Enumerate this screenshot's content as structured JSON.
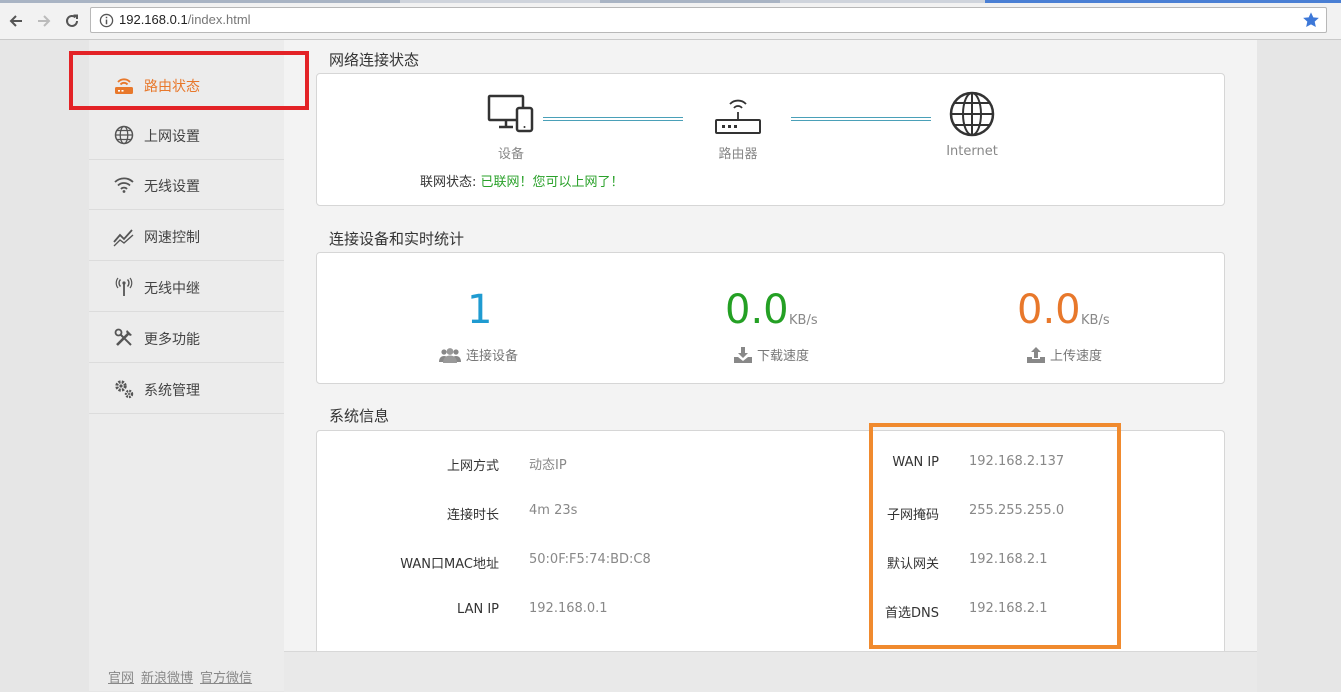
{
  "browser": {
    "url_host": "192.168.0.1",
    "url_path": "/index.html"
  },
  "sidebar": {
    "items": [
      {
        "label": "路由状态",
        "icon": "router-icon",
        "active": true
      },
      {
        "label": "上网设置",
        "icon": "globe-icon"
      },
      {
        "label": "无线设置",
        "icon": "wifi-icon"
      },
      {
        "label": "网速控制",
        "icon": "speed-chart-icon"
      },
      {
        "label": "无线中继",
        "icon": "antenna-icon"
      },
      {
        "label": "更多功能",
        "icon": "tools-icon"
      },
      {
        "label": "系统管理",
        "icon": "gears-icon"
      }
    ],
    "footer_links": [
      "官网",
      "新浪微博",
      "官方微信"
    ]
  },
  "network": {
    "title": "网络连接状态",
    "device_label": "设备",
    "router_label": "路由器",
    "internet_label": "Internet",
    "status_label": "联网状态:",
    "status_value": "已联网！您可以上网了！"
  },
  "stats": {
    "title": "连接设备和实时统计",
    "devices": {
      "value": "1",
      "caption": "连接设备"
    },
    "download": {
      "value": "0.0",
      "unit": "KB/s",
      "caption": "下载速度"
    },
    "upload": {
      "value": "0.0",
      "unit": "KB/s",
      "caption": "上传速度"
    }
  },
  "sysinfo": {
    "title": "系统信息",
    "left": [
      {
        "label": "上网方式",
        "value": "动态IP"
      },
      {
        "label": "连接时长",
        "value": "4m 23s"
      },
      {
        "label": "WAN口MAC地址",
        "value": "50:0F:F5:74:BD:C8"
      },
      {
        "label": "LAN IP",
        "value": "192.168.0.1"
      }
    ],
    "right": [
      {
        "label": "WAN IP",
        "value": "192.168.2.137"
      },
      {
        "label": "子网掩码",
        "value": "255.255.255.0"
      },
      {
        "label": "默认网关",
        "value": "192.168.2.1"
      },
      {
        "label": "首选DNS",
        "value": "192.168.2.1"
      }
    ]
  },
  "colors": {
    "accent_orange": "#e8782b",
    "devices_blue": "#1f9bd1",
    "download_green": "#24a024",
    "upload_orange": "#e8782b",
    "annotation_red": "#e32226",
    "annotation_orange": "#f08a2e"
  }
}
